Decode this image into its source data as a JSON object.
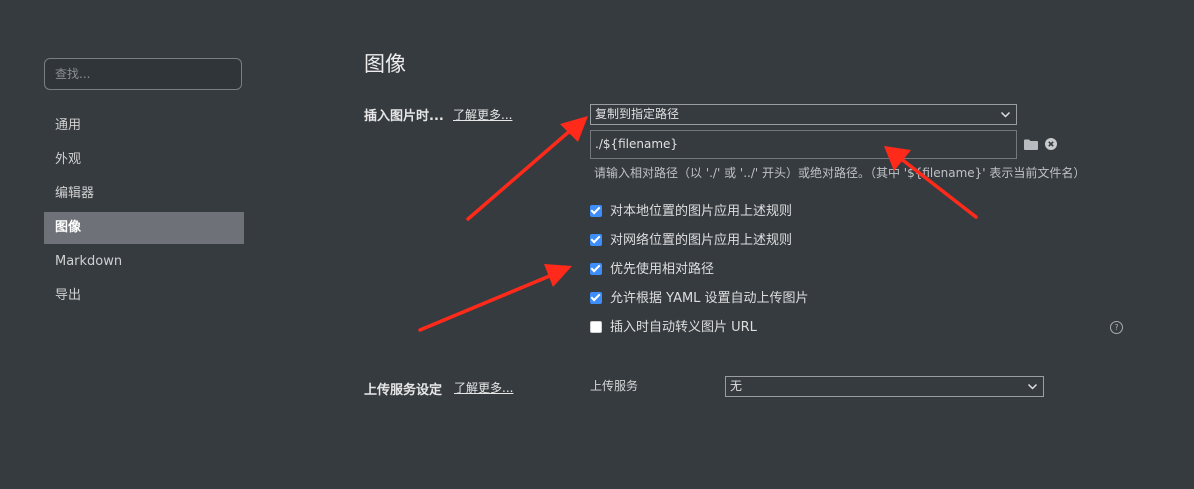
{
  "sidebar": {
    "search_placeholder": "查找...",
    "items": [
      {
        "label": "通用"
      },
      {
        "label": "外观"
      },
      {
        "label": "编辑器"
      },
      {
        "label": "图像",
        "active": true
      },
      {
        "label": "Markdown"
      },
      {
        "label": "导出"
      }
    ]
  },
  "page": {
    "title": "图像"
  },
  "insert_image": {
    "label": "插入图片时...",
    "learn_more": "了解更多...",
    "action_selected": "复制到指定路径",
    "path_value": "./${filename}",
    "hint": "请输入相对路径（以 './' 或 '../' 开头）或绝对路径。（其中 '${filename}' 表示当前文件名）",
    "options": [
      {
        "label": "对本地位置的图片应用上述规则",
        "checked": true
      },
      {
        "label": "对网络位置的图片应用上述规则",
        "checked": true
      },
      {
        "label": "优先使用相对路径",
        "checked": true
      },
      {
        "label": "允许根据 YAML 设置自动上传图片",
        "checked": true
      },
      {
        "label": "插入时自动转义图片 URL",
        "checked": false
      }
    ]
  },
  "upload": {
    "label": "上传服务设定",
    "learn_more": "了解更多...",
    "service_label": "上传服务",
    "service_selected": "无"
  },
  "colors": {
    "background": "#363b40",
    "active_nav": "#6e7177",
    "checkbox": "#3d8dfa",
    "annotation_arrow": "#ff2a1a"
  },
  "icons": {
    "folder": "folder-icon",
    "clear": "clear-icon",
    "help": "help-icon",
    "caret": "chevron-down-icon"
  }
}
